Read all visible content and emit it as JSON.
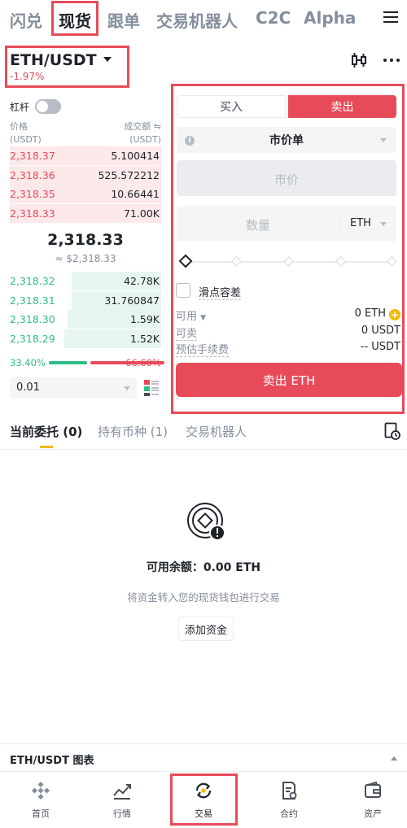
{
  "top_nav": {
    "tabs": [
      "闪兑",
      "现货",
      "跟单",
      "交易机器人",
      "C2C",
      "Alpha"
    ],
    "active": "现货"
  },
  "pair": {
    "symbol": "ETH/USDT",
    "change": "-1.97%"
  },
  "order_book": {
    "leverage_label": "杠杆",
    "price_header": "价格",
    "price_unit": "(USDT)",
    "volume_header": "成交额",
    "volume_unit": "(USDT)",
    "asks": [
      {
        "price": "2,318.37",
        "amount": "5.100414",
        "depth": 1.0
      },
      {
        "price": "2,318.36",
        "amount": "525.572212",
        "depth": 1.0
      },
      {
        "price": "2,318.35",
        "amount": "10.66441",
        "depth": 1.0
      },
      {
        "price": "2,318.33",
        "amount": "71.00K",
        "depth": 1.0
      }
    ],
    "last_price": "2,318.33",
    "last_price_fiat": "≈ $2,318.33",
    "bids": [
      {
        "price": "2,318.32",
        "amount": "42.78K",
        "depth": 0.59
      },
      {
        "price": "2,318.31",
        "amount": "31.760847",
        "depth": 0.59
      },
      {
        "price": "2,318.30",
        "amount": "1.59K",
        "depth": 0.62
      },
      {
        "price": "2,318.29",
        "amount": "1.52K",
        "depth": 0.64
      }
    ],
    "buy_ratio": "33.40%",
    "sell_ratio": "66.60%",
    "buy_ratio_value": 33.4,
    "depth_value": "0.01"
  },
  "order_form": {
    "buy_label": "买入",
    "sell_label": "卖出",
    "order_type": "市价单",
    "price_placeholder": "市价",
    "quantity_placeholder": "数量",
    "quantity_unit": "ETH",
    "slippage_label": "滑点容差",
    "available_label": "可用",
    "available_value": "0 ETH",
    "sellable_label": "可卖",
    "sellable_value": "0 USDT",
    "fee_label": "预估手续费",
    "fee_value": "-- USDT",
    "submit_label": "卖出 ETH"
  },
  "orders_tabs": [
    {
      "label": "当前委托 (0)"
    },
    {
      "label": "持有币种 (1)"
    },
    {
      "label": "交易机器人"
    }
  ],
  "empty_state": {
    "title": "可用余额：0.00 ETH",
    "subtitle": "将资金转入您的现货钱包进行交易",
    "button": "添加资金"
  },
  "chart_bar": {
    "label": "ETH/USDT 图表"
  },
  "bottom_nav": [
    {
      "label": "首页",
      "icon": "home-icon"
    },
    {
      "label": "行情",
      "icon": "markets-icon"
    },
    {
      "label": "交易",
      "icon": "trade-icon"
    },
    {
      "label": "合约",
      "icon": "futures-icon"
    },
    {
      "label": "资产",
      "icon": "wallet-icon"
    }
  ],
  "colors": {
    "accent_red": "#e74b5a",
    "accent_green": "#2ebd85",
    "brand_yellow": "#f0b90b"
  }
}
